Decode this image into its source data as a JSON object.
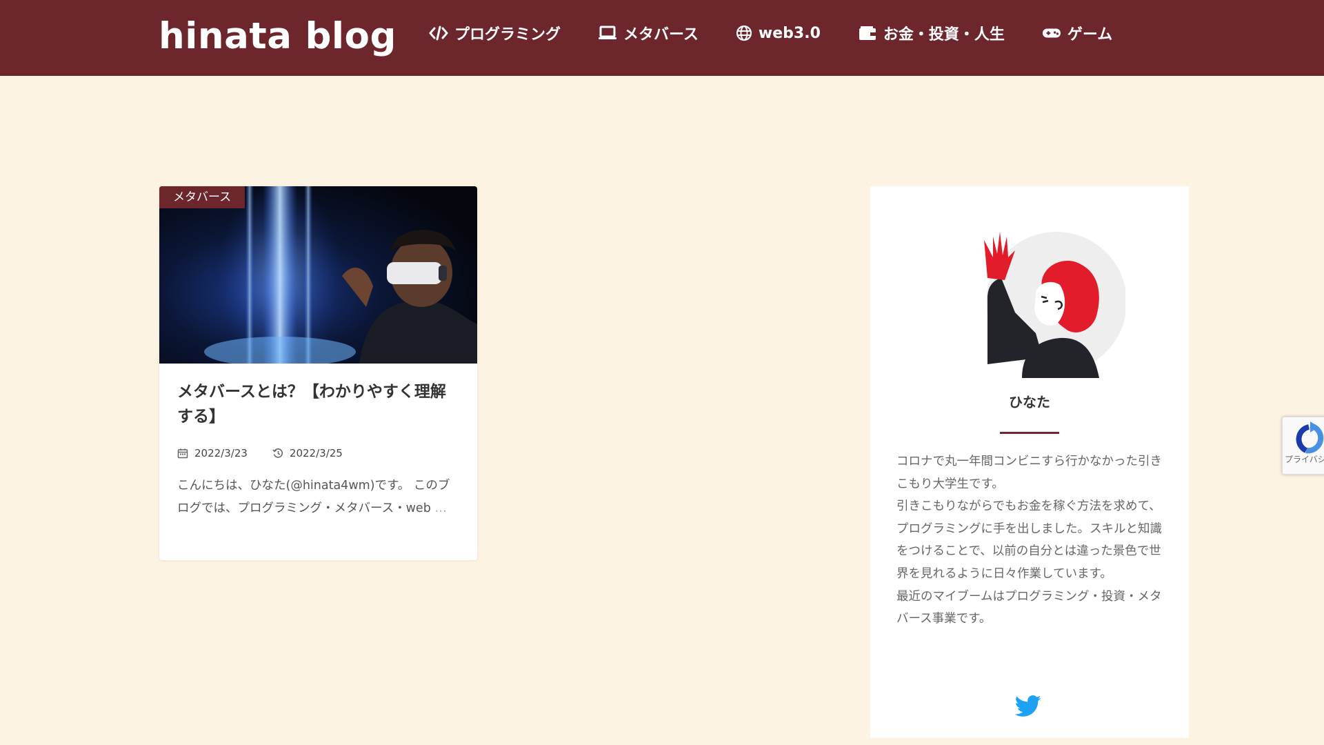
{
  "header": {
    "logo": "hinata blog",
    "bg_color": "#6e262d",
    "nav": [
      {
        "label": "プログラミング",
        "icon": "code-icon"
      },
      {
        "label": "メタバース",
        "icon": "laptop-icon"
      },
      {
        "label": "web3.0",
        "icon": "globe-icon"
      },
      {
        "label": "お金・投資・人生",
        "icon": "wallet-icon"
      },
      {
        "label": "ゲーム",
        "icon": "gamepad-icon"
      }
    ]
  },
  "post": {
    "category": "メタバース",
    "title": "メタバースとは？【わかりやすく理解する】",
    "published": "2022/3/23",
    "updated": "2022/3/25",
    "excerpt": "こんにちは、ひなた(@hinata4wm)です。 このブログでは、プログラミング・メタバース・web",
    "more": " …"
  },
  "profile": {
    "name": "ひなた",
    "bio": [
      "コロナで丸一年間コンビニすら行かなかった引きこもり大学生です。",
      "引きこもりながらでもお金を稼ぐ方法を求めて、プログラミングに手を出しました。スキルと知識をつけることで、以前の自分とは違った景色で世界を見れるように日々作業しています。",
      "最近のマイブームはプログラミング・投資・メタバース事業です。"
    ],
    "social": "twitter-icon",
    "twitter_color": "#1da1f2"
  },
  "recaptcha": {
    "text": "プライバシー・利用規約"
  }
}
